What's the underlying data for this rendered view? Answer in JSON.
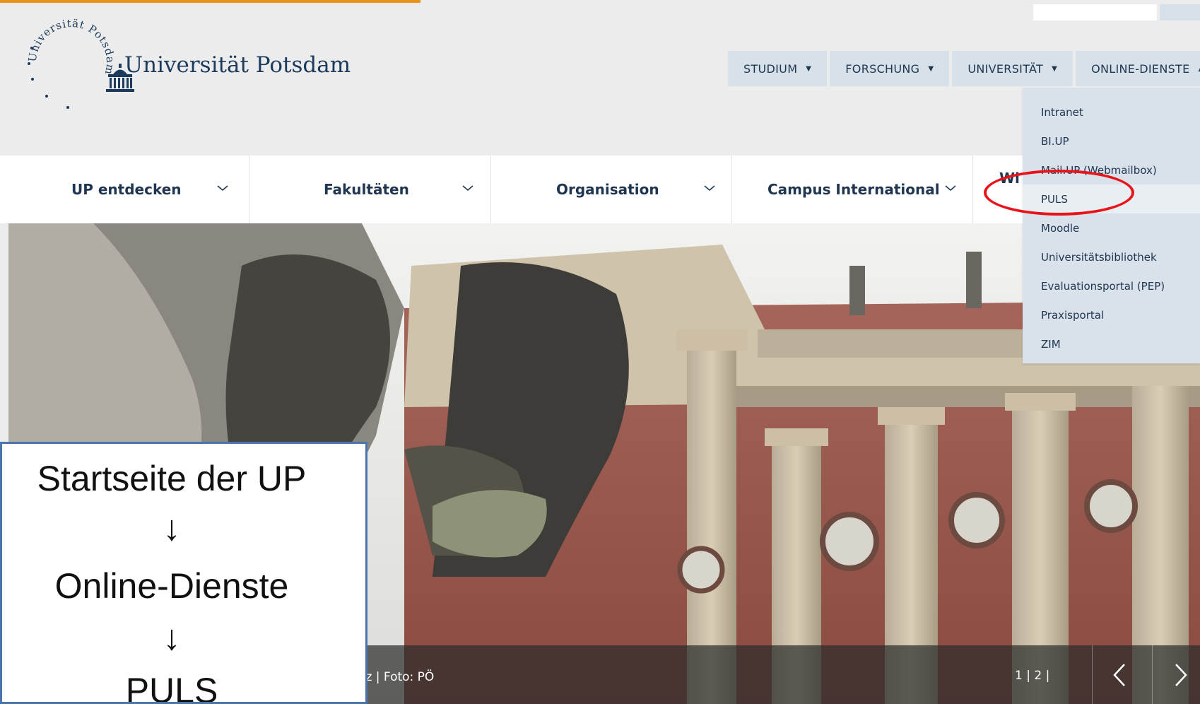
{
  "logo": {
    "seal_text": "Universität Potsdam",
    "title": "Universität Potsdam"
  },
  "topnav": {
    "items": [
      {
        "label": "STUDIUM"
      },
      {
        "label": "FORSCHUNG"
      },
      {
        "label": "UNIVERSITÄT"
      },
      {
        "label": "ONLINE-DIENSTE"
      }
    ],
    "caret": "▼",
    "caret_open": "▲"
  },
  "dropdown": {
    "items": [
      {
        "label": "Intranet"
      },
      {
        "label": "BI.UP"
      },
      {
        "label": "Mail.UP (Webmailbox)"
      },
      {
        "label": "PULS"
      },
      {
        "label": "Moodle"
      },
      {
        "label": "Universitätsbibliothek"
      },
      {
        "label": "Evaluationsportal (PEP)"
      },
      {
        "label": "Praxisportal"
      },
      {
        "label": "ZIM"
      }
    ]
  },
  "secnav": {
    "items": [
      {
        "label": "UP entdecken"
      },
      {
        "label": "Fakultäten"
      },
      {
        "label": "Organisation"
      },
      {
        "label": "Campus International"
      },
      {
        "label": "Wi"
      }
    ]
  },
  "hero": {
    "caption": "utz | Foto: PÖ",
    "pager": "1 | 2 |"
  },
  "annotation": {
    "line1": "Startseite der UP",
    "arrow1": "↓",
    "line2": "Online-Dienste",
    "arrow2": "↓",
    "line3": "PULS"
  },
  "colors": {
    "accent_orange": "#e8911c",
    "nav_bg": "#d7e1ea",
    "text_navy": "#1f3550",
    "highlight_red": "#e8141a",
    "annotation_border": "#4a76b0"
  },
  "icons": {
    "building": "university-building-icon",
    "prev": "chevron-left-icon",
    "next": "chevron-right-icon",
    "expand": "chevron-down-icon"
  }
}
